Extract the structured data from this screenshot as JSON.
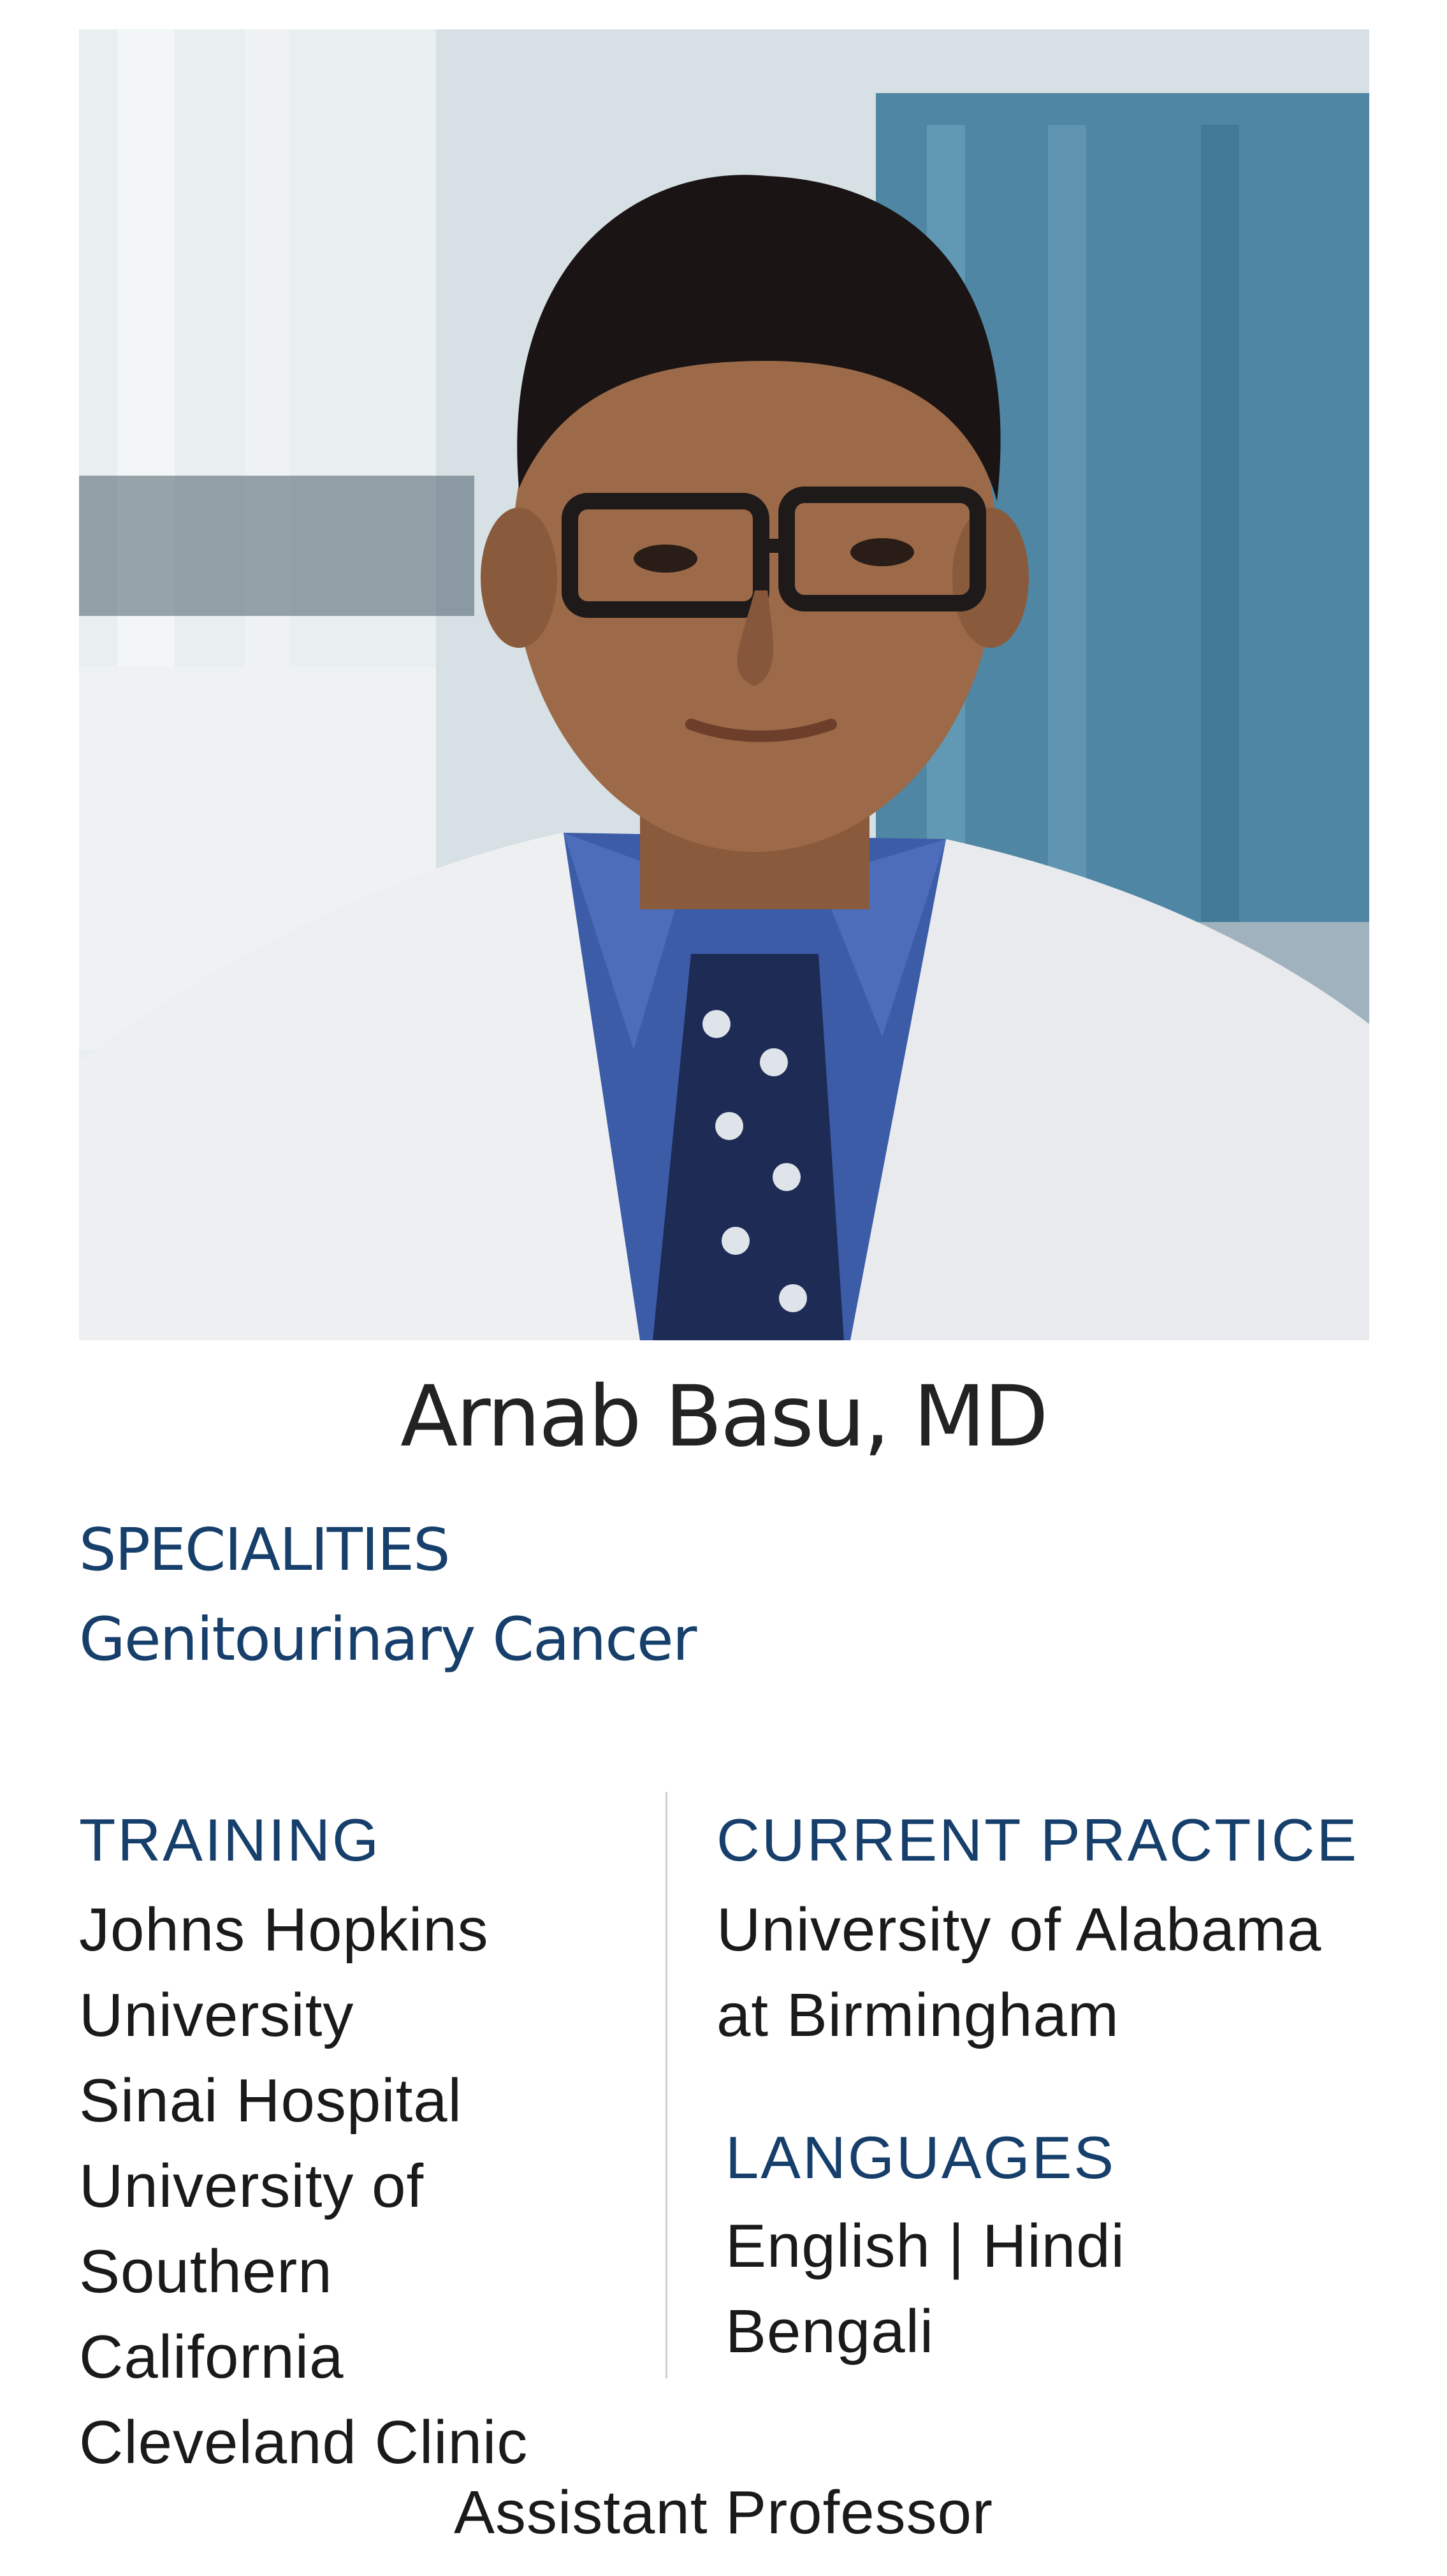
{
  "profile": {
    "name": "Arnab Basu, MD",
    "title": "Assistant Professor"
  },
  "specialities": {
    "heading": "SPECIALITIES",
    "value": "Genitourinary Cancer"
  },
  "training": {
    "heading": "TRAINING",
    "lines": [
      "Johns Hopkins",
      "University",
      "Sinai Hospital",
      "University of",
      "Southern",
      "California",
      "Cleveland Clinic"
    ]
  },
  "current_practice": {
    "heading": "CURRENT PRACTICE",
    "lines": [
      "University of Alabama",
      "at Birmingham"
    ]
  },
  "languages": {
    "heading": "LANGUAGES",
    "lines": [
      "English | Hindi",
      "Bengali"
    ]
  },
  "colors": {
    "heading_blue": "#173f6b",
    "body_text": "#1a1a1a",
    "divider": "#c8d0d6"
  }
}
